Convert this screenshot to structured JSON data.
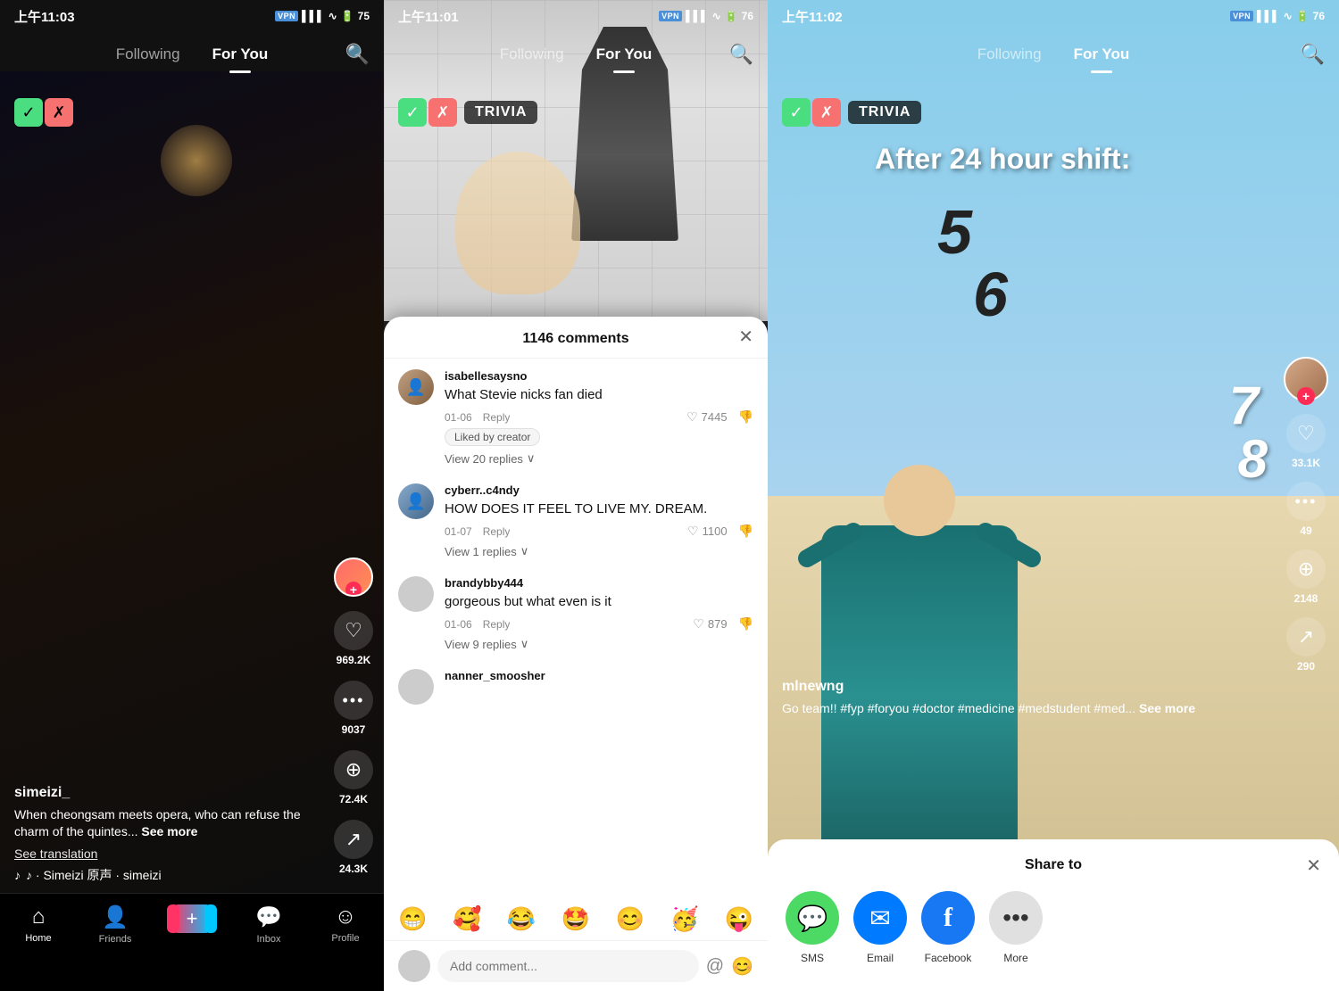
{
  "panel1": {
    "status": {
      "time": "上午11:03",
      "vpn": "VPN",
      "battery": "75"
    },
    "nav": {
      "following": "Following",
      "for_you": "For You",
      "active_tab": "for_you"
    },
    "video": {
      "username": "simeizi_",
      "caption": "When cheongsam meets opera, who can refuse the charm of the quintes...",
      "see_more": "See more",
      "translation": "See translation",
      "music": "♪  · Simeizi  原声 · simeizi"
    },
    "actions": {
      "likes": "969.2K",
      "comments": "9037",
      "bookmarks": "72.4K",
      "shares": "24.3K"
    },
    "bottom_nav": {
      "home": "Home",
      "friends": "Friends",
      "inbox": "Inbox",
      "profile": "Profile"
    }
  },
  "panel2": {
    "status": {
      "time": "上午11:01",
      "vpn": "VPN",
      "battery": "76"
    },
    "nav": {
      "following": "Following",
      "for_you": "For You"
    },
    "trivia": {
      "label": "TRIVIA"
    },
    "comments": {
      "title": "1146 comments",
      "items": [
        {
          "username": "isabellesaysno",
          "text": "What Stevie nicks fan died",
          "date": "01-06",
          "reply": "Reply",
          "likes": "7445",
          "liked_by_creator": "Liked by creator",
          "view_replies": "View 20 replies"
        },
        {
          "username": "cyberr..c4ndy",
          "text": "HOW DOES IT FEEL TO LIVE MY. DREAM.",
          "date": "01-07",
          "reply": "Reply",
          "likes": "1100",
          "view_replies": "View 1 replies"
        },
        {
          "username": "brandybby444",
          "text": "gorgeous but what even is it",
          "date": "01-06",
          "reply": "Reply",
          "likes": "879",
          "view_replies": "View 9 replies"
        },
        {
          "username": "nanner_smoosher",
          "text": "",
          "date": "",
          "reply": "",
          "likes": ""
        }
      ],
      "input_placeholder": "Add comment...",
      "emojis": [
        "😁",
        "🥰",
        "😂",
        "🤩",
        "😊",
        "🥳",
        "😜"
      ]
    }
  },
  "panel3": {
    "status": {
      "time": "上午11:02",
      "vpn": "VPN",
      "battery": "76"
    },
    "nav": {
      "following": "Following",
      "for_you": "For You"
    },
    "trivia": {
      "label": "TRIVIA"
    },
    "video": {
      "text_overlay": "After 24 hour shift:",
      "counts": [
        "5",
        "6",
        "7",
        "8"
      ],
      "username": "mlnewng",
      "caption": "Go team!! #fyp #foryou #doctor #medicine #medstudent #med...",
      "see_more": "See more"
    },
    "actions": {
      "likes": "33.1K",
      "comments": "49",
      "bookmarks": "2148",
      "shares": "290"
    },
    "share": {
      "title": "Share to",
      "items": [
        {
          "label": "SMS",
          "icon": "sms"
        },
        {
          "label": "Email",
          "icon": "email"
        },
        {
          "label": "Facebook",
          "icon": "facebook"
        },
        {
          "label": "More",
          "icon": "more"
        }
      ]
    }
  }
}
